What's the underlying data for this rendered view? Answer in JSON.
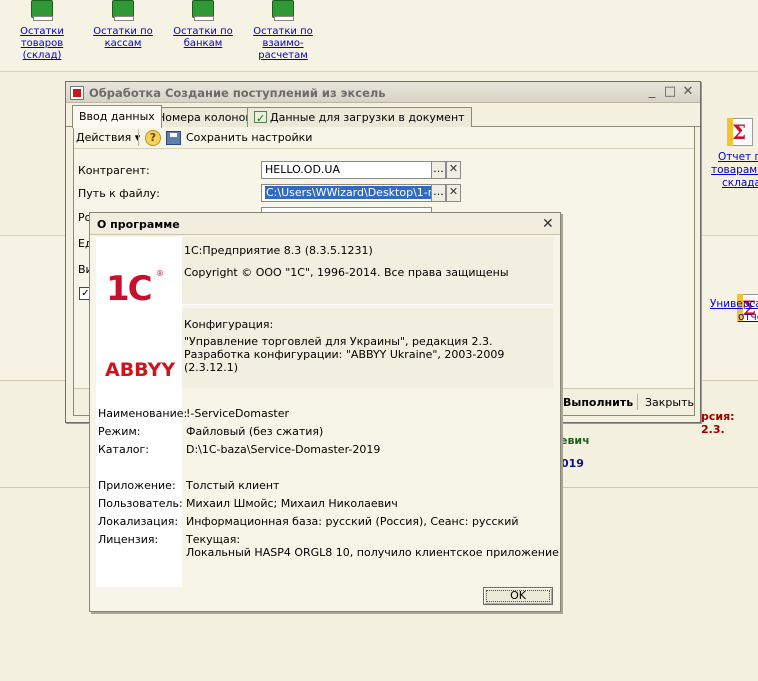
{
  "desktop": {
    "shortcuts": [
      {
        "label": "Остатки товаров (склад)",
        "lines": [
          "Остатки",
          "товаров",
          "(склад)"
        ]
      },
      {
        "label": "Остатки по кассам",
        "lines": [
          "Остатки по",
          "кассам"
        ]
      },
      {
        "label": "Остатки по банкам",
        "lines": [
          "Остатки по",
          "банкам"
        ]
      },
      {
        "label": "Остатки по взаиморасчетам",
        "lines": [
          "Остатки по",
          "взаимо-",
          "расчетам"
        ]
      }
    ],
    "side_reports": [
      {
        "lines": [
          "Отчет по",
          "товарам на",
          "складах"
        ]
      },
      {
        "lines": [
          "Универсал",
          "отче"
        ]
      }
    ],
    "version_fragment": "рсия: 2.3.",
    "green_fragment": "евич",
    "blue_fragment": "019"
  },
  "window": {
    "title": "Обработка  Создание поступлений из эксель",
    "tabs": [
      {
        "label": "Ввод данных"
      },
      {
        "label": "Номера колонок"
      },
      {
        "label": "Данные для загрузки в документ"
      }
    ],
    "toolbar": {
      "actions_label": "Действия",
      "help_label": "?",
      "save_settings_label": "Сохранить настройки"
    },
    "fields": {
      "counterparty_label": "Контрагент:",
      "counterparty_value": "HELLO.OD.UA",
      "path_label": "Путь к файлу:",
      "path_value": "C:\\Users\\WWizard\\Desktop\\1-rea",
      "row3_label": "Ро",
      "row4_label": "Ед",
      "row5_label": "Ви"
    },
    "buttons": {
      "run": "Выполнить",
      "close": "Закрыть",
      "select_glyph": "...",
      "clear_glyph": "✕"
    }
  },
  "about": {
    "title": "О программе",
    "close_glyph": "✕",
    "product": "1С:Предприятие 8.3 (8.3.5.1231)",
    "copyright": "Copyright © ООО \"1С\", 1996-2014. Все права защищены",
    "logo_1c": "1С",
    "logo_abbyy": "ABBYY",
    "config_label": "Конфигурация:",
    "config_lines": [
      "\"Управление торговлей для Украины\", редакция 2.3.",
      "Разработка конфигурации: \"ABBYY Ukraine\", 2003-2009",
      " (2.3.12.1)"
    ],
    "details": [
      {
        "label": "Наименование:",
        "value": "!-ServiceDomaster"
      },
      {
        "label": "Режим:",
        "value": "Файловый (без сжатия)"
      },
      {
        "label": "Каталог:",
        "value": "D:\\1C-baza\\Service-Domaster-2019"
      },
      {
        "label": "Приложение:",
        "value": "Толстый клиент"
      },
      {
        "label": "Пользователь:",
        "value": "Михаил Шмойс; Михаил Николаевич"
      },
      {
        "label": "Локализация:",
        "value": "Информационная база: русский (Россия), Сеанс: русский"
      },
      {
        "label": "Лицензия:",
        "value": "Текущая:"
      }
    ],
    "license_detail": "Локальный HASP4 ORGL8 10, получило клиентское приложение",
    "ok_label": "OK"
  }
}
